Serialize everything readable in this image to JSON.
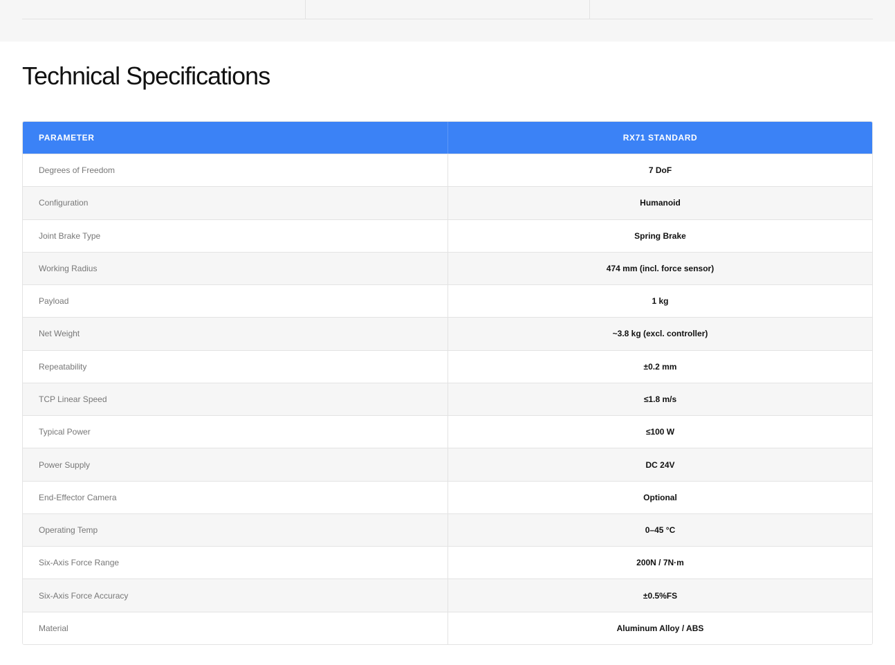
{
  "section": {
    "title": "Technical Specifications"
  },
  "table": {
    "header": {
      "parameter": "PARAMETER",
      "value": "RX71 STANDARD"
    },
    "rows": [
      {
        "parameter": "Degrees of Freedom",
        "value": "7 DoF"
      },
      {
        "parameter": "Configuration",
        "value": "Humanoid"
      },
      {
        "parameter": "Joint Brake Type",
        "value": "Spring Brake"
      },
      {
        "parameter": "Working Radius",
        "value": "474 mm (incl. force sensor)"
      },
      {
        "parameter": "Payload",
        "value": "1 kg"
      },
      {
        "parameter": "Net Weight",
        "value": "~3.8 kg (excl. controller)"
      },
      {
        "parameter": "Repeatability",
        "value": "±0.2 mm"
      },
      {
        "parameter": "TCP Linear Speed",
        "value": "≤1.8 m/s"
      },
      {
        "parameter": "Typical Power",
        "value": "≤100 W"
      },
      {
        "parameter": "Power Supply",
        "value": "DC 24V"
      },
      {
        "parameter": "End-Effector Camera",
        "value": "Optional"
      },
      {
        "parameter": "Operating Temp",
        "value": "0–45 °C"
      },
      {
        "parameter": "Six-Axis Force Range",
        "value": "200N / 7N·m"
      },
      {
        "parameter": "Six-Axis Force Accuracy",
        "value": "±0.5%FS"
      },
      {
        "parameter": "Material",
        "value": "Aluminum Alloy / ABS"
      }
    ]
  },
  "colors": {
    "header_bg": "#3b82f6",
    "header_text": "#ffffff",
    "row_alt_bg": "#f6f6f6",
    "param_text": "#777777",
    "value_text": "#111111",
    "border": "#e3e3e3"
  }
}
